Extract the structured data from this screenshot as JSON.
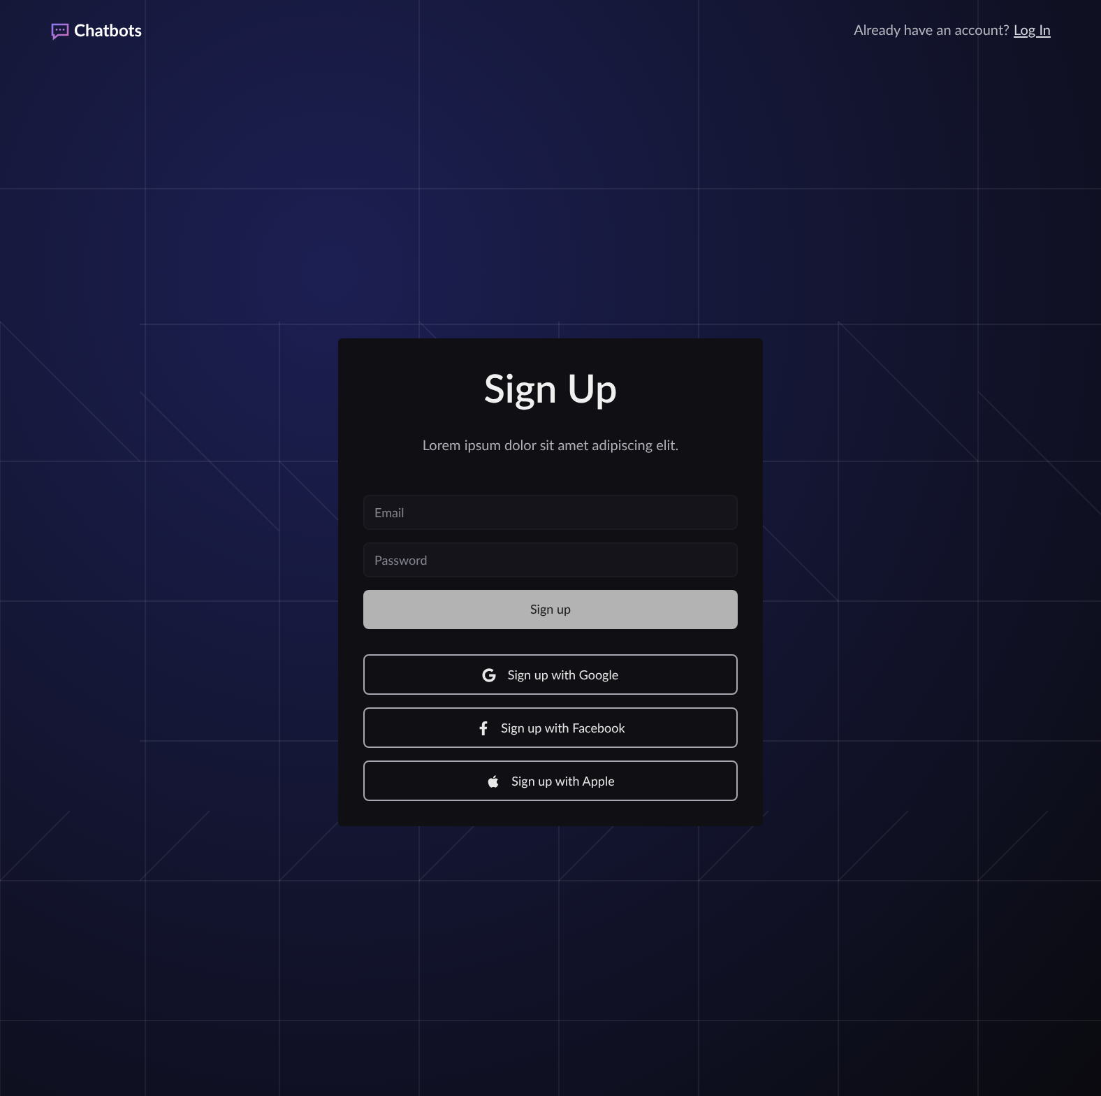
{
  "header": {
    "brand": "Chatbots",
    "prompt": "Already have an account?",
    "login_link": "Log In"
  },
  "card": {
    "title": "Sign Up",
    "subtitle": "Lorem ipsum dolor sit amet adipiscing elit.",
    "fields": [
      {
        "placeholder": "Email"
      },
      {
        "placeholder": "Password"
      }
    ],
    "submit": "Sign up",
    "social_buttons": [
      {
        "kind": "google",
        "label": "Sign up with Google"
      },
      {
        "kind": "facebook",
        "label": "Sign up with Facebook"
      },
      {
        "kind": "apple",
        "label": "Sign up with Apple"
      }
    ]
  }
}
